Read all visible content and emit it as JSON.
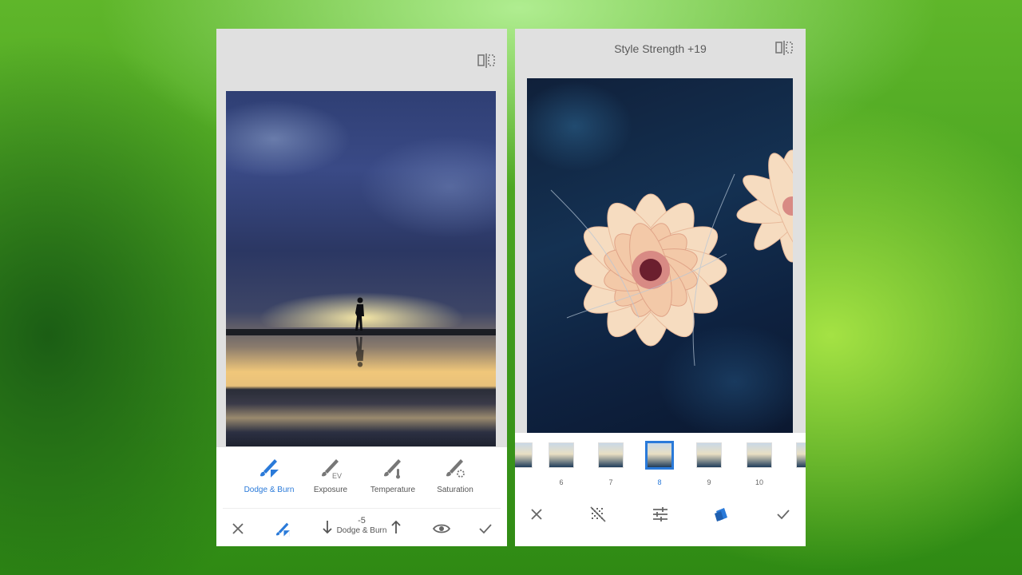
{
  "left_screen": {
    "tools": [
      {
        "label": "Dodge & Burn",
        "icon": "dodge-burn-brush-icon",
        "active": true
      },
      {
        "label": "Exposure",
        "icon": "exposure-brush-icon",
        "active": false
      },
      {
        "label": "Temperature",
        "icon": "temperature-brush-icon",
        "active": false
      },
      {
        "label": "Saturation",
        "icon": "saturation-brush-icon",
        "active": false
      }
    ],
    "adjust": {
      "value": "-5",
      "name": "Dodge & Burn"
    },
    "bottom_icons": [
      "close-icon",
      "brush-icon",
      "arrow-down-icon",
      "arrow-up-icon",
      "eye-icon",
      "check-icon"
    ]
  },
  "right_screen": {
    "title": "Style Strength +19",
    "filters": [
      {
        "label": "",
        "selected": false
      },
      {
        "label": "6",
        "selected": false
      },
      {
        "label": "7",
        "selected": false
      },
      {
        "label": "8",
        "selected": true
      },
      {
        "label": "9",
        "selected": false
      },
      {
        "label": "10",
        "selected": false
      },
      {
        "label": "",
        "selected": false
      }
    ],
    "bottom_icons": [
      "close-icon",
      "texture-icon",
      "tune-icon",
      "style-icon",
      "check-icon"
    ]
  },
  "colors": {
    "accent": "#2a7ad9",
    "panel": "#ffffff",
    "screen_bg": "#e0e0e0"
  }
}
